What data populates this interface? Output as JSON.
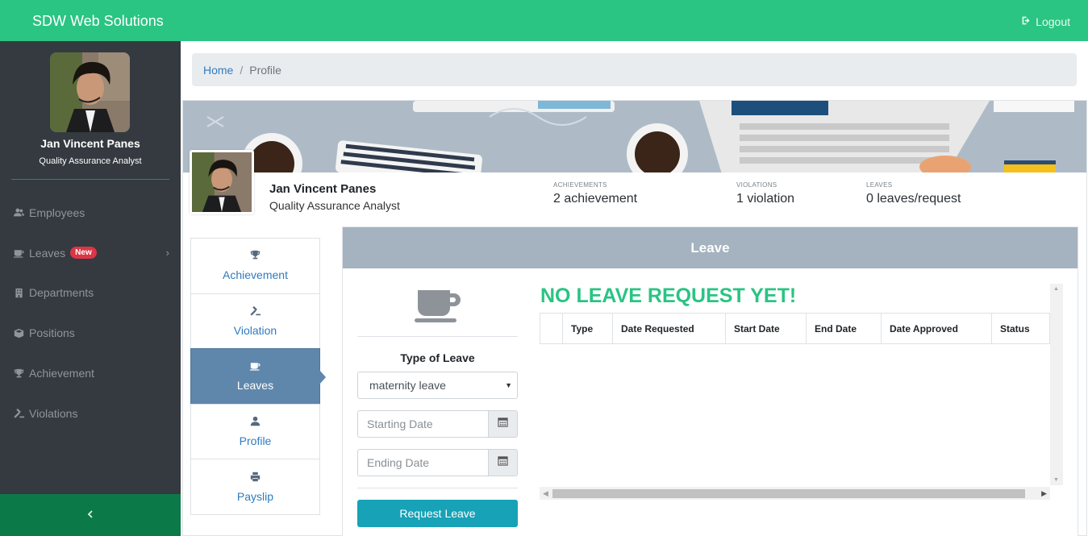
{
  "app": {
    "brand": "SDW Web Solutions",
    "logout_label": "Logout"
  },
  "sidebar": {
    "name": "Jan Vincent Panes",
    "role": "Quality Assurance Analyst",
    "items": [
      {
        "label": "Employees",
        "icon": "users-icon"
      },
      {
        "label": "Leaves",
        "icon": "coffee-icon",
        "badge": "New"
      },
      {
        "label": "Departments",
        "icon": "building-icon"
      },
      {
        "label": "Positions",
        "icon": "cube-icon"
      },
      {
        "label": "Achievement",
        "icon": "trophy-icon"
      },
      {
        "label": "Violations",
        "icon": "gavel-icon"
      }
    ]
  },
  "breadcrumb": {
    "home": "Home",
    "separator": "/",
    "current": "Profile"
  },
  "profile": {
    "name": "Jan Vincent Panes",
    "role": "Quality Assurance Analyst",
    "stats": [
      {
        "label": "ACHIEVEMENTS",
        "value": "2 achievement"
      },
      {
        "label": "VIOLATIONS",
        "value": "1 violation"
      },
      {
        "label": "LEAVES",
        "value": "0 leaves/request"
      }
    ]
  },
  "tabs": [
    {
      "label": "Achievement",
      "icon": "trophy-icon"
    },
    {
      "label": "Violation",
      "icon": "gavel-icon"
    },
    {
      "label": "Leaves",
      "icon": "coffee-icon",
      "active": true
    },
    {
      "label": "Profile",
      "icon": "user-icon"
    },
    {
      "label": "Payslip",
      "icon": "print-icon"
    }
  ],
  "leave_panel": {
    "title": "Leave",
    "type_label": "Type of Leave",
    "type_selected": "maternity leave",
    "start_placeholder": "Starting Date",
    "end_placeholder": "Ending Date",
    "request_button": "Request Leave",
    "empty_message": "NO LEAVE REQUEST YET!",
    "columns": [
      "",
      "Type",
      "Date Requested",
      "Start Date",
      "End Date",
      "Date Approved",
      "Status"
    ]
  },
  "colors": {
    "accent": "#2ac483",
    "sidebar": "#343a40",
    "active_tab": "#5f87ab",
    "button": "#17a2b8"
  }
}
